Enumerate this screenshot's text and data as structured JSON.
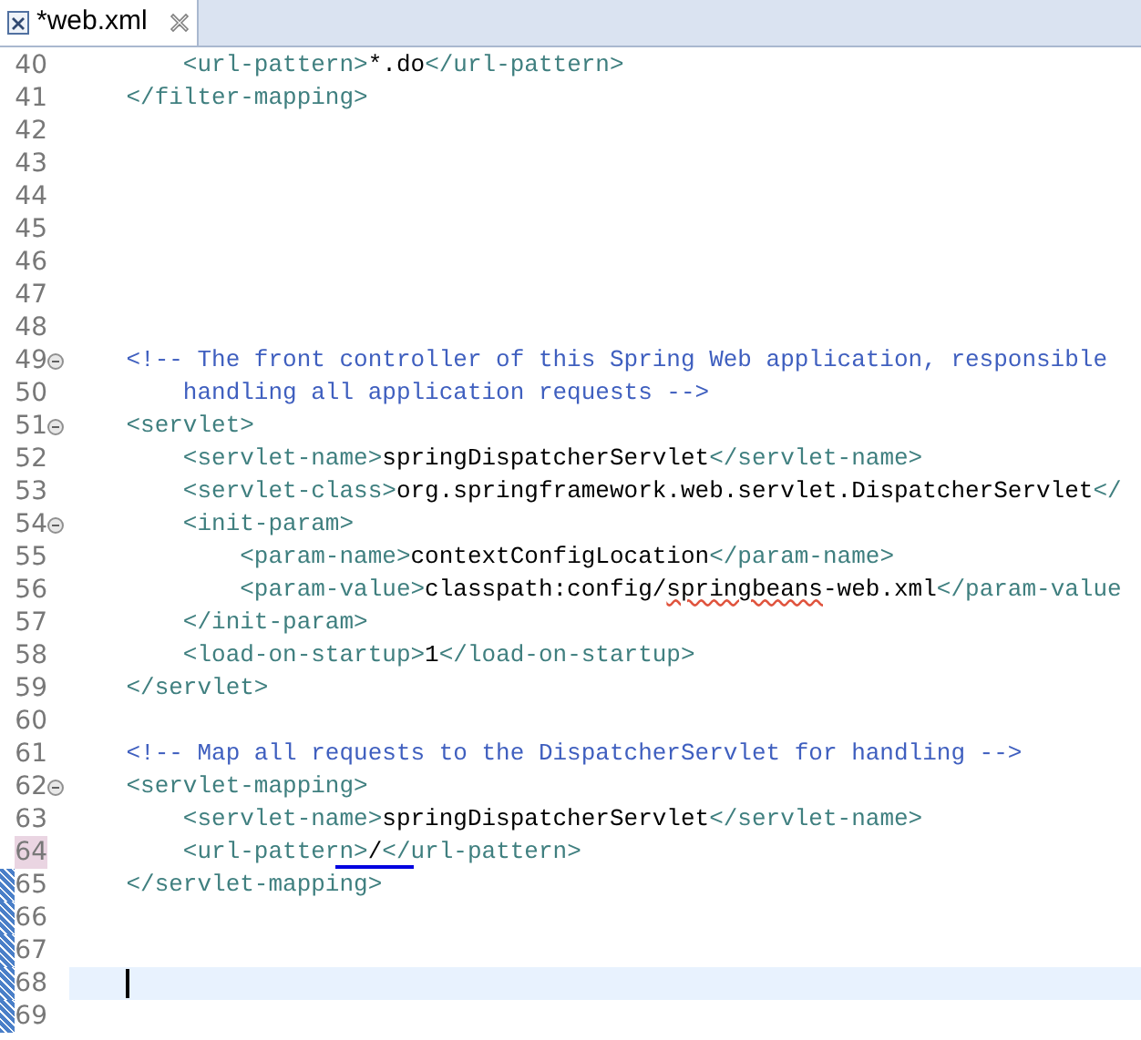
{
  "tab": {
    "label": "*web.xml",
    "selected": true
  },
  "lines": [
    {
      "number": "40",
      "segments": [
        {
          "kind": "tag",
          "text": "        <url-pattern>"
        },
        {
          "kind": "text",
          "text": "*.do"
        },
        {
          "kind": "tag",
          "text": "</url-pattern>"
        }
      ]
    },
    {
      "number": "41",
      "segments": [
        {
          "kind": "tag",
          "text": "    </filter-mapping>"
        }
      ]
    },
    {
      "number": "42"
    },
    {
      "number": "43"
    },
    {
      "number": "44"
    },
    {
      "number": "45"
    },
    {
      "number": "46"
    },
    {
      "number": "47"
    },
    {
      "number": "48"
    },
    {
      "number": "49",
      "fold": true,
      "segments": [
        {
          "kind": "comment",
          "text": "    <!-- The front controller of this Spring Web application, responsible"
        }
      ]
    },
    {
      "number": "50",
      "segments": [
        {
          "kind": "comment",
          "text": "        handling all application requests -->"
        }
      ]
    },
    {
      "number": "51",
      "fold": true,
      "segments": [
        {
          "kind": "tag",
          "text": "    <servlet>"
        }
      ]
    },
    {
      "number": "52",
      "segments": [
        {
          "kind": "tag",
          "text": "        <servlet-name>"
        },
        {
          "kind": "text",
          "text": "springDispatcherServlet"
        },
        {
          "kind": "tag",
          "text": "</servlet-name>"
        }
      ]
    },
    {
      "number": "53",
      "segments": [
        {
          "kind": "tag",
          "text": "        <servlet-class>"
        },
        {
          "kind": "text",
          "text": "org.springframework.web.servlet.DispatcherServlet"
        },
        {
          "kind": "tag",
          "text": "</"
        }
      ]
    },
    {
      "number": "54",
      "fold": true,
      "segments": [
        {
          "kind": "tag",
          "text": "        <init-param>"
        }
      ]
    },
    {
      "number": "55",
      "segments": [
        {
          "kind": "tag",
          "text": "            <param-name>"
        },
        {
          "kind": "text",
          "text": "contextConfigLocation"
        },
        {
          "kind": "tag",
          "text": "</param-name>"
        }
      ]
    },
    {
      "number": "56",
      "segments": [
        {
          "kind": "tag",
          "text": "            <param-value>"
        },
        {
          "kind": "text",
          "text": "classpath:config/"
        },
        {
          "kind": "misspelled",
          "text": "springbeans"
        },
        {
          "kind": "text",
          "text": "-web.xml"
        },
        {
          "kind": "tag",
          "text": "</param-value"
        }
      ]
    },
    {
      "number": "57",
      "segments": [
        {
          "kind": "tag",
          "text": "        </init-param>"
        }
      ]
    },
    {
      "number": "58",
      "segments": [
        {
          "kind": "tag",
          "text": "        <load-on-startup>"
        },
        {
          "kind": "text",
          "text": "1"
        },
        {
          "kind": "tag",
          "text": "</load-on-startup>"
        }
      ]
    },
    {
      "number": "59",
      "segments": [
        {
          "kind": "tag",
          "text": "    </servlet>"
        }
      ]
    },
    {
      "number": "60"
    },
    {
      "number": "61",
      "segments": [
        {
          "kind": "comment",
          "text": "    <!-- Map all requests to the DispatcherServlet for handling -->"
        }
      ]
    },
    {
      "number": "62",
      "fold": true,
      "segments": [
        {
          "kind": "tag",
          "text": "    <servlet-mapping>"
        }
      ]
    },
    {
      "number": "63",
      "segments": [
        {
          "kind": "tag",
          "text": "        <servlet-name>"
        },
        {
          "kind": "text",
          "text": "springDispatcherServlet"
        },
        {
          "kind": "tag",
          "text": "</servlet-name>"
        }
      ]
    },
    {
      "number": "64",
      "highlighted": true,
      "segments": [
        {
          "kind": "tag",
          "text": "        <url-pattern>"
        },
        {
          "kind": "text",
          "text": "/"
        },
        {
          "kind": "tag",
          "text": "</url-pattern>"
        }
      ],
      "matched": true
    },
    {
      "number": "65",
      "changed": true,
      "segments": [
        {
          "kind": "tag",
          "text": "    </servlet-mapping>"
        }
      ]
    },
    {
      "number": "66",
      "changed": true
    },
    {
      "number": "67",
      "changed": true
    },
    {
      "number": "68",
      "changed": true,
      "current": true
    },
    {
      "number": "69",
      "changed": true
    }
  ]
}
